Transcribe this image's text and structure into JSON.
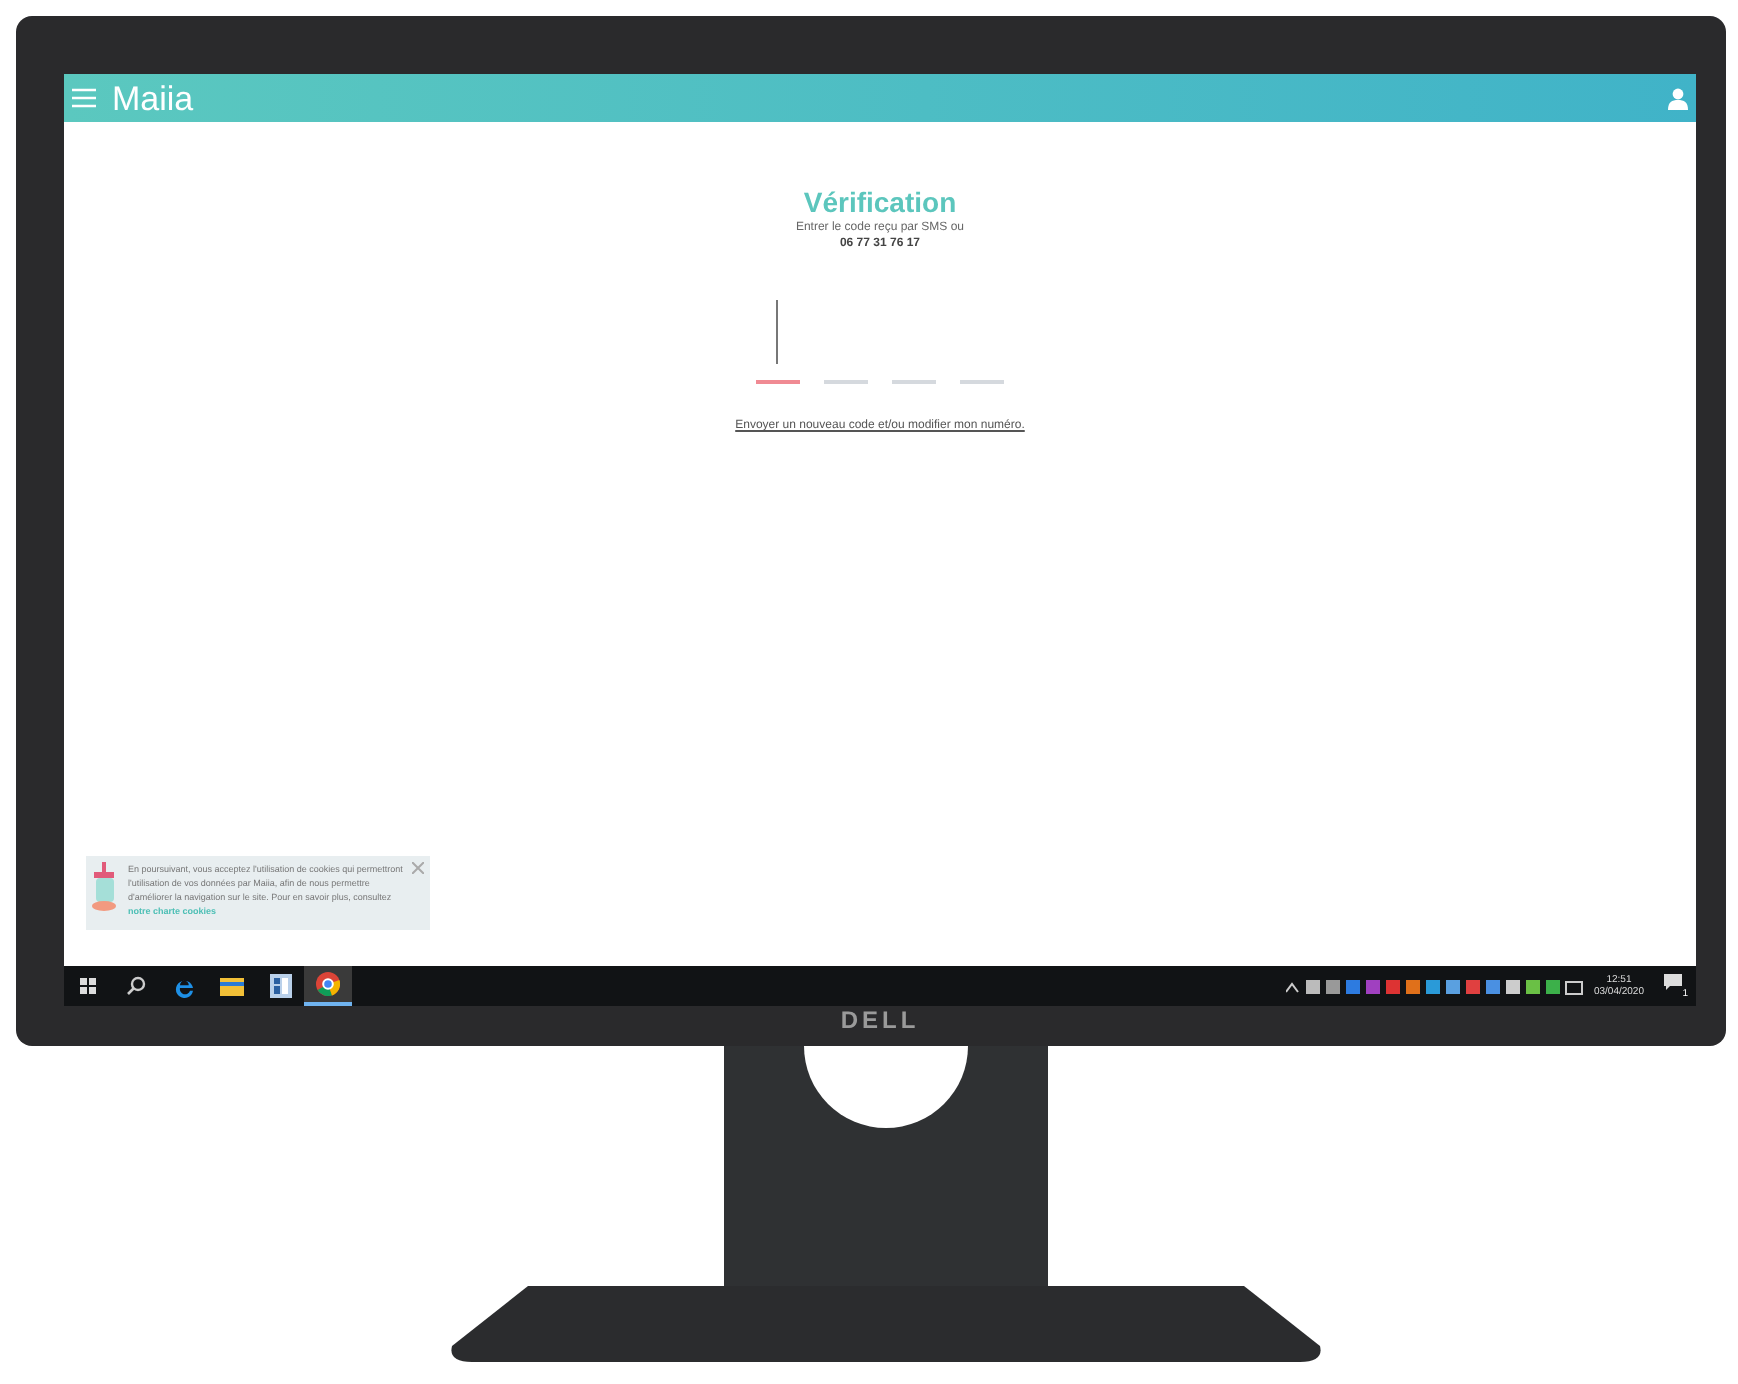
{
  "app_bar": {
    "logo": "Maiia"
  },
  "verification": {
    "title": "Vérification",
    "instruction": "Entrer le code reçu par SMS ou",
    "phone": "06 77 31 76 17",
    "code_fields": [
      {
        "selected": true
      },
      {
        "selected": false
      },
      {
        "selected": false
      },
      {
        "selected": false
      }
    ],
    "link": "Envoyer un nouveau code et/ou modifier mon numéro."
  },
  "cookie_banner": {
    "text": "En poursuivant, vous acceptez l'utilisation de cookies qui permettront l'utilisation de vos données par Maiia, afin de nous permettre d'améliorer la navigation sur le site. Pour en savoir plus, consultez",
    "link": "notre charte cookies"
  },
  "taskbar": {
    "apps": [
      {
        "kind": "search",
        "selected": false
      },
      {
        "kind": "edge",
        "selected": false
      },
      {
        "kind": "folder",
        "selected": false
      },
      {
        "kind": "document",
        "selected": false
      },
      {
        "kind": "chrome",
        "selected": true
      }
    ],
    "clock": {
      "time": "12:51",
      "date": "03/04/2020"
    },
    "notification_count": "1"
  },
  "monitor": {
    "brand": "DELL"
  }
}
